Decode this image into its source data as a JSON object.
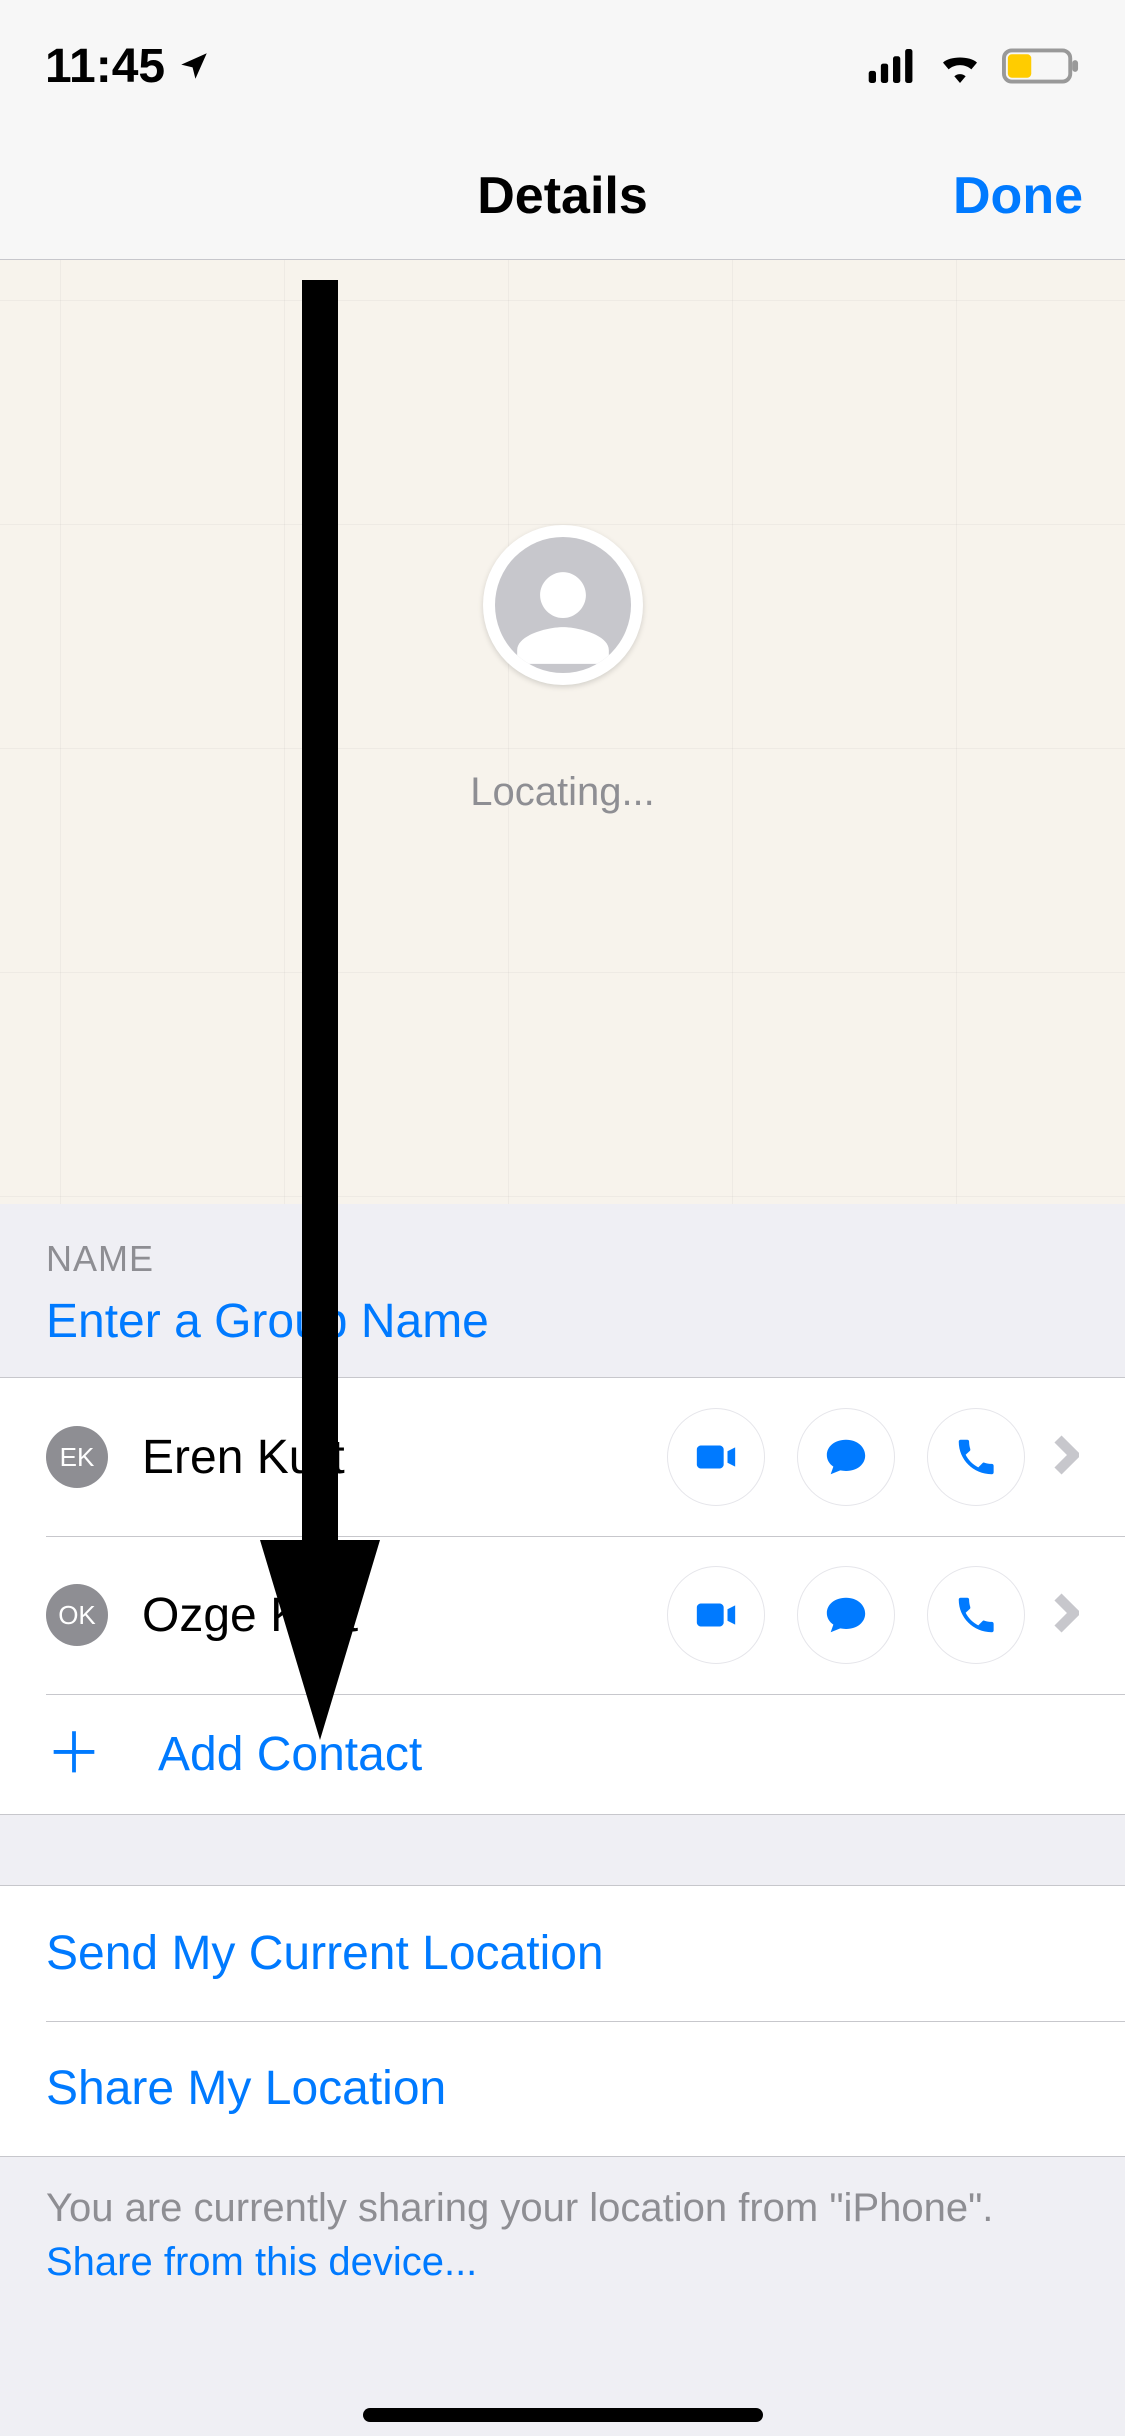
{
  "status": {
    "time": "11:45",
    "location_icon": "location-arrow"
  },
  "nav": {
    "title": "Details",
    "done": "Done"
  },
  "map": {
    "status": "Locating..."
  },
  "name_section": {
    "header": "NAME",
    "placeholder": "Enter a Group Name"
  },
  "contacts": [
    {
      "initials": "EK",
      "name": "Eren Kurt"
    },
    {
      "initials": "OK",
      "name": "Ozge Kurt"
    }
  ],
  "add_contact": "Add Contact",
  "location": {
    "send": "Send My Current Location",
    "share": "Share My Location"
  },
  "footer": {
    "text": "You are currently sharing your location from \"iPhone\". ",
    "link": "Share from this device..."
  }
}
